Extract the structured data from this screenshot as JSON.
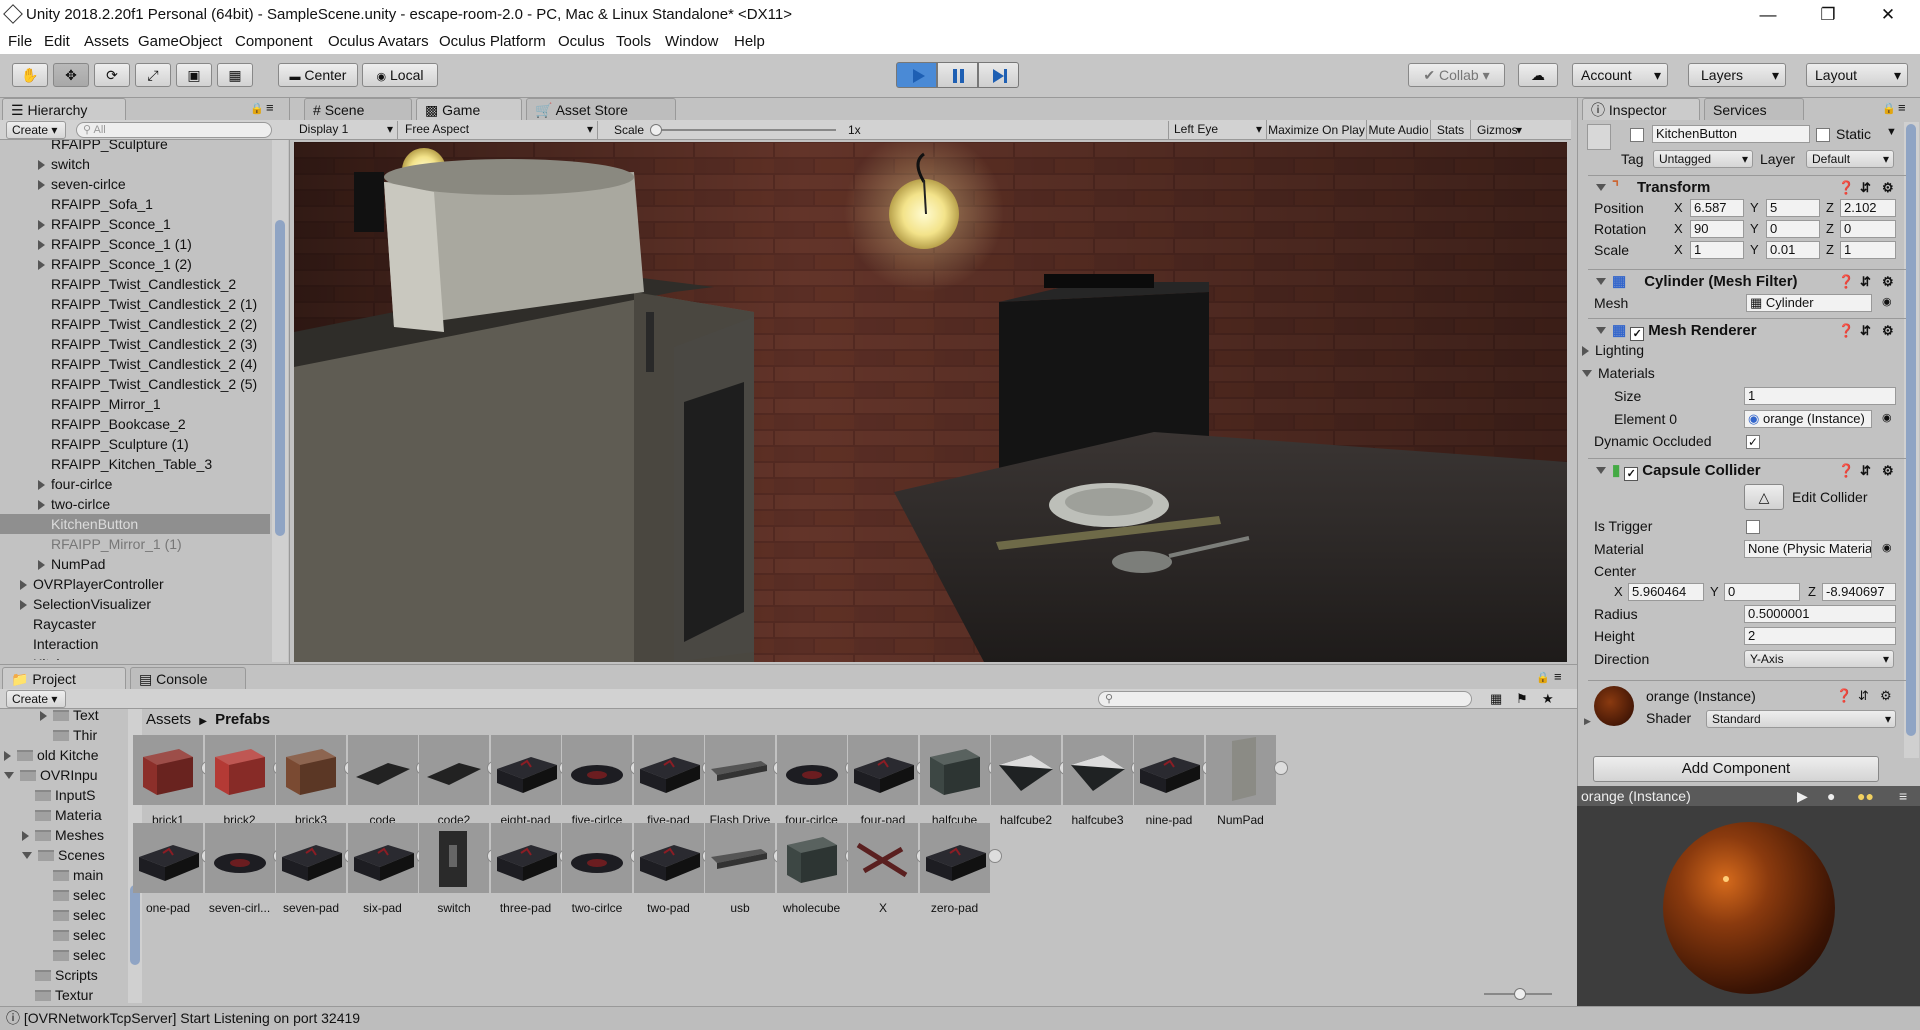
{
  "title": "Unity 2018.2.20f1 Personal (64bit) - SampleScene.unity - escape-room-2.0 - PC, Mac & Linux Standalone* <DX11>",
  "menu": [
    "File",
    "Edit",
    "Assets",
    "GameObject",
    "Component",
    "Oculus Avatars",
    "Oculus Platform",
    "Oculus",
    "Tools",
    "Window",
    "Help"
  ],
  "toolbar": {
    "center": "Center",
    "local": "Local",
    "collab": "Collab",
    "account": "Account",
    "layers": "Layers",
    "layout": "Layout"
  },
  "tabs": {
    "hierarchy": "Hierarchy",
    "scene": "Scene",
    "game": "Game",
    "asset_store": "Asset Store",
    "inspector": "Inspector",
    "services": "Services",
    "project": "Project",
    "console": "Console"
  },
  "hierarchy": {
    "create": "Create",
    "search_placeholder": "All",
    "items": [
      {
        "label": "RFAIPP_Sculpture",
        "arrow": false,
        "indent": 2
      },
      {
        "label": "switch",
        "arrow": true,
        "indent": 2
      },
      {
        "label": "seven-cirlce",
        "arrow": true,
        "indent": 2
      },
      {
        "label": "RFAIPP_Sofa_1",
        "arrow": false,
        "indent": 2
      },
      {
        "label": "RFAIPP_Sconce_1",
        "arrow": true,
        "indent": 2
      },
      {
        "label": "RFAIPP_Sconce_1 (1)",
        "arrow": true,
        "indent": 2
      },
      {
        "label": "RFAIPP_Sconce_1 (2)",
        "arrow": true,
        "indent": 2
      },
      {
        "label": "RFAIPP_Twist_Candlestick_2",
        "arrow": false,
        "indent": 2
      },
      {
        "label": "RFAIPP_Twist_Candlestick_2 (1)",
        "arrow": false,
        "indent": 2
      },
      {
        "label": "RFAIPP_Twist_Candlestick_2 (2)",
        "arrow": false,
        "indent": 2
      },
      {
        "label": "RFAIPP_Twist_Candlestick_2 (3)",
        "arrow": false,
        "indent": 2
      },
      {
        "label": "RFAIPP_Twist_Candlestick_2 (4)",
        "arrow": false,
        "indent": 2
      },
      {
        "label": "RFAIPP_Twist_Candlestick_2 (5)",
        "arrow": false,
        "indent": 2
      },
      {
        "label": "RFAIPP_Mirror_1",
        "arrow": false,
        "indent": 2
      },
      {
        "label": "RFAIPP_Bookcase_2",
        "arrow": false,
        "indent": 2
      },
      {
        "label": "RFAIPP_Sculpture (1)",
        "arrow": false,
        "indent": 2
      },
      {
        "label": "RFAIPP_Kitchen_Table_3",
        "arrow": false,
        "indent": 2
      },
      {
        "label": "four-cirlce",
        "arrow": true,
        "indent": 2
      },
      {
        "label": "two-cirlce",
        "arrow": true,
        "indent": 2
      },
      {
        "label": "KitchenButton",
        "arrow": false,
        "indent": 2,
        "selected": true
      },
      {
        "label": "RFAIPP_Mirror_1 (1)",
        "arrow": false,
        "indent": 2,
        "dim": true
      },
      {
        "label": "NumPad",
        "arrow": true,
        "indent": 2
      },
      {
        "label": "OVRPlayerController",
        "arrow": true,
        "indent": 1
      },
      {
        "label": "SelectionVisualizer",
        "arrow": true,
        "indent": 1
      },
      {
        "label": "Raycaster",
        "arrow": false,
        "indent": 1
      },
      {
        "label": "Interaction",
        "arrow": false,
        "indent": 1
      },
      {
        "label": "Kitchen",
        "arrow": true,
        "indent": 1
      }
    ]
  },
  "game": {
    "display": "Display 1",
    "aspect": "Free Aspect",
    "scale_label": "Scale",
    "scale_value": "1x",
    "scale_level": 0.0,
    "eye": "Left Eye",
    "maximize": "Maximize On Play",
    "mute": "Mute Audio",
    "stats": "Stats",
    "gizmos": "Gizmos"
  },
  "inspector": {
    "object_name": "KitchenButton",
    "static": "Static",
    "tag_label": "Tag",
    "tag": "Untagged",
    "layer_label": "Layer",
    "layer": "Default",
    "transform": {
      "title": "Transform",
      "rows": [
        {
          "label": "Position",
          "x": "6.587",
          "y": "5",
          "z": "2.102"
        },
        {
          "label": "Rotation",
          "x": "90",
          "y": "0",
          "z": "0"
        },
        {
          "label": "Scale",
          "x": "1",
          "y": "0.01",
          "z": "1"
        }
      ]
    },
    "mesh_filter": {
      "title": "Cylinder (Mesh Filter)",
      "mesh_label": "Mesh",
      "mesh": "Cylinder"
    },
    "mesh_renderer": {
      "title": "Mesh Renderer",
      "lighting": "Lighting",
      "materials": "Materials",
      "size_label": "Size",
      "size": "1",
      "element_label": "Element 0",
      "element": "orange (Instance)",
      "dynamic_label": "Dynamic Occluded"
    },
    "capsule": {
      "title": "Capsule Collider",
      "edit": "Edit Collider",
      "trigger_label": "Is Trigger",
      "material_label": "Material",
      "material": "None (Physic Material)",
      "center_label": "Center",
      "cx": "5.960464",
      "cy": "0",
      "cz": "-8.940697",
      "radius_label": "Radius",
      "radius": "0.5000001",
      "height_label": "Height",
      "height": "2",
      "direction_label": "Direction",
      "direction": "Y-Axis"
    },
    "material": {
      "name": "orange (Instance)",
      "shader_label": "Shader",
      "shader": "Standard"
    },
    "add_component": "Add Component",
    "preview_title": "orange (Instance)"
  },
  "project": {
    "create": "Create",
    "breadcrumb_root": "Assets",
    "breadcrumb_current": "Prefabs",
    "tree": [
      {
        "label": "Text",
        "indent": 3,
        "arrow": "right"
      },
      {
        "label": "Thir",
        "indent": 3,
        "arrow": "none"
      },
      {
        "label": "old Kitche",
        "indent": 1,
        "arrow": "right"
      },
      {
        "label": "OVRInpu",
        "indent": 1,
        "arrow": "down"
      },
      {
        "label": "InputS",
        "indent": 2,
        "arrow": "none"
      },
      {
        "label": "Materia",
        "indent": 2,
        "arrow": "none"
      },
      {
        "label": "Meshes",
        "indent": 2,
        "arrow": "right"
      },
      {
        "label": "Scenes",
        "indent": 2,
        "arrow": "down"
      },
      {
        "label": "main",
        "indent": 3,
        "arrow": "none"
      },
      {
        "label": "selec",
        "indent": 3,
        "arrow": "none"
      },
      {
        "label": "selec",
        "indent": 3,
        "arrow": "none"
      },
      {
        "label": "selec",
        "indent": 3,
        "arrow": "none"
      },
      {
        "label": "selec",
        "indent": 3,
        "arrow": "none"
      },
      {
        "label": "Scripts",
        "indent": 2,
        "arrow": "none"
      },
      {
        "label": "Textur",
        "indent": 2,
        "arrow": "none"
      }
    ],
    "assets_row1": [
      {
        "label": "brick1",
        "color": "#8c2f2a",
        "shape": "cube"
      },
      {
        "label": "brick2",
        "color": "#b43a35",
        "shape": "cube"
      },
      {
        "label": "brick3",
        "color": "#7a4a32",
        "shape": "cube"
      },
      {
        "label": "code",
        "color": "#222",
        "shape": "flat"
      },
      {
        "label": "code2",
        "color": "#222",
        "shape": "flat"
      },
      {
        "label": "eight-pad",
        "color": "#1d1d22",
        "shape": "pad"
      },
      {
        "label": "five-cirlce",
        "color": "#1d1d22",
        "shape": "disc"
      },
      {
        "label": "five-pad",
        "color": "#1d1d22",
        "shape": "pad"
      },
      {
        "label": "Flash Drive",
        "color": "#555",
        "shape": "stick"
      },
      {
        "label": "four-cirlce",
        "color": "#1d1d22",
        "shape": "disc"
      },
      {
        "label": "four-pad",
        "color": "#1d1d22",
        "shape": "pad"
      },
      {
        "label": "halfcube",
        "color": "#3d4744",
        "shape": "cube"
      },
      {
        "label": "halfcube2",
        "color": "#1f2223",
        "shape": "wedge"
      },
      {
        "label": "halfcube3",
        "color": "#1f2223",
        "shape": "wedge"
      },
      {
        "label": "nine-pad",
        "color": "#1d1d22",
        "shape": "pad"
      },
      {
        "label": "NumPad",
        "color": "#8b8b85",
        "shape": "panel"
      }
    ],
    "assets_row2": [
      {
        "label": "one-pad",
        "color": "#1d1d22",
        "shape": "pad"
      },
      {
        "label": "seven-cirl...",
        "color": "#1d1d22",
        "shape": "disc"
      },
      {
        "label": "seven-pad",
        "color": "#1d1d22",
        "shape": "pad"
      },
      {
        "label": "six-pad",
        "color": "#1d1d22",
        "shape": "pad"
      },
      {
        "label": "switch",
        "color": "#2a2a2a",
        "shape": "switch"
      },
      {
        "label": "three-pad",
        "color": "#1d1d22",
        "shape": "pad"
      },
      {
        "label": "two-cirlce",
        "color": "#1d1d22",
        "shape": "disc"
      },
      {
        "label": "two-pad",
        "color": "#1d1d22",
        "shape": "pad"
      },
      {
        "label": "usb",
        "color": "#555",
        "shape": "stick"
      },
      {
        "label": "wholecube",
        "color": "#3d4744",
        "shape": "cube"
      },
      {
        "label": "X",
        "color": "#5a2020",
        "shape": "x"
      },
      {
        "label": "zero-pad",
        "color": "#1d1d22",
        "shape": "pad"
      }
    ]
  },
  "status": "[OVRNetworkTcpServer] Start Listening on port 32419",
  "colors": {
    "accent": "#4a8ad6",
    "selection": "#8f8f8f"
  }
}
